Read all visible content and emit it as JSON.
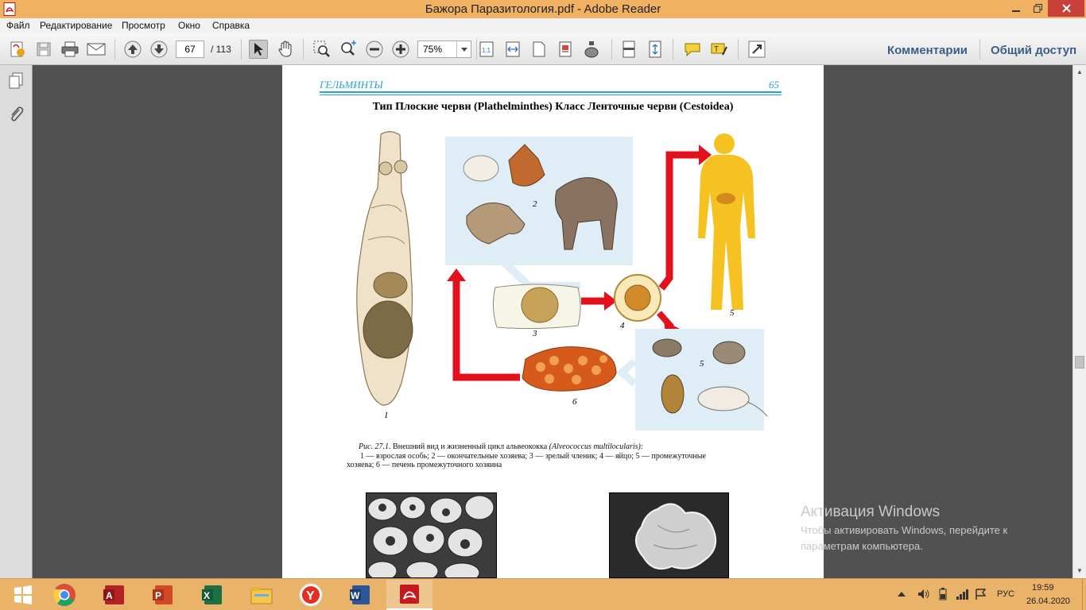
{
  "window": {
    "title": "Бажора Паразитология.pdf - Adobe Reader",
    "app_icon": "adobe-reader-icon"
  },
  "menu": {
    "items": [
      "Файл",
      "Редактирование",
      "Просмотр",
      "Окно",
      "Справка"
    ]
  },
  "toolbar": {
    "current_page": "67",
    "total_pages": "/ 113",
    "zoom": "75%",
    "comments_label": "Комментарии",
    "share_label": "Общий доступ"
  },
  "document": {
    "running_head_left": "ГЕЛЬМИНТЫ",
    "running_head_right": "65",
    "heading": "Тип Плоские черви (Plathelminthes) Класс Ленточные черви (Cestoidea)",
    "labels": {
      "n1": "1",
      "n2": "2",
      "n3": "3",
      "n4": "4",
      "n5a": "5",
      "n5b": "5",
      "n6": "6"
    },
    "caption_line1_prefix": "Рис. 27.1.",
    "caption_line1_text": " Внешний вид и жизненный цикл альвеококка ",
    "caption_line1_latin": "(Alveococcus multilocularis):",
    "caption_line2": "1 — взрослая особь; 2 — окончательные хозяева; 3 — зрелый членик; 4 — яйцо; 5 — промежуточные",
    "caption_line3": "хозяева; 6 — печень промежуточного хозяина"
  },
  "watermark": {
    "title": "Активация Windows",
    "line1": "Чтобы активировать Windows, перейдите к",
    "line2": "параметрам компьютера."
  },
  "taskbar": {
    "apps": [
      "start-icon",
      "chrome-icon",
      "access-icon",
      "powerpoint-icon",
      "excel-icon",
      "file-explorer-icon",
      "yandex-browser-icon",
      "word-icon",
      "adobe-reader-icon"
    ],
    "language": "РУС",
    "time": "19:59",
    "date": "26.04.2020"
  },
  "colors": {
    "titlebar": "#f0b163",
    "close_button": "#c7403a",
    "accent_blue": "#2aa1d8",
    "arrow_red": "#e3101e",
    "human_yellow": "#f5c221",
    "link_blue": "#3b5f86"
  }
}
